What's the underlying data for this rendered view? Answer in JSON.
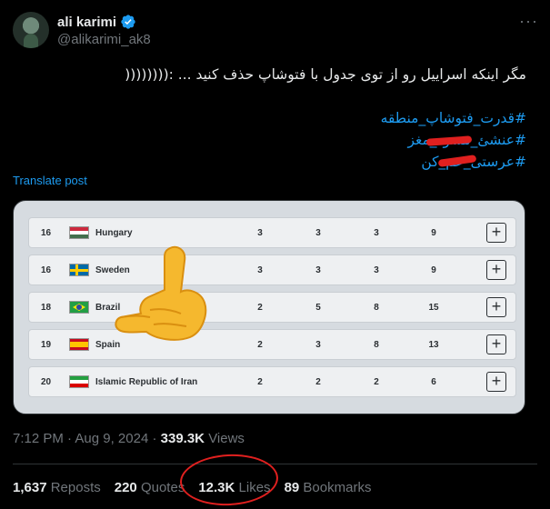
{
  "author": {
    "name": "ali karimi",
    "handle": "@alikarimi_ak8"
  },
  "tweet": {
    "text": "مگر اینکه اسراییل رو از توی جدول  با فتوشاپ حذف کنید ... :((((((((",
    "hashtags": [
      "#قدرت_فتوشاپ_منطقه",
      "#عنشئ_مسود_مغز",
      "#عرستی_عم_کن"
    ],
    "translate_label": "Translate post"
  },
  "medal_table": {
    "rows": [
      {
        "rank": "16",
        "country": "Hungary",
        "gold": "3",
        "silver": "3",
        "bronze": "3",
        "total": "9",
        "flag": "hungary-flag"
      },
      {
        "rank": "16",
        "country": "Sweden",
        "gold": "3",
        "silver": "3",
        "bronze": "3",
        "total": "9",
        "flag": "sweden-flag"
      },
      {
        "rank": "18",
        "country": "Brazil",
        "gold": "2",
        "silver": "5",
        "bronze": "8",
        "total": "15",
        "flag": "brazil-flag"
      },
      {
        "rank": "19",
        "country": "Spain",
        "gold": "2",
        "silver": "3",
        "bronze": "8",
        "total": "13",
        "flag": "spain-flag"
      },
      {
        "rank": "20",
        "country": "Islamic Republic of Iran",
        "gold": "2",
        "silver": "2",
        "bronze": "2",
        "total": "6",
        "flag": "iran-flag"
      }
    ],
    "expand_label": "+"
  },
  "meta": {
    "time": "7:12 PM",
    "separator": " · ",
    "date": "Aug 9, 2024",
    "views_count": "339.3K",
    "views_label": "Views"
  },
  "stats": {
    "reposts_count": "1,637",
    "reposts_label": "Reposts",
    "quotes_count": "220",
    "quotes_label": "Quotes",
    "likes_count": "12.3K",
    "likes_label": "Likes",
    "bookmarks_count": "89",
    "bookmarks_label": "Bookmarks"
  },
  "colors": {
    "background": "#000000",
    "accent": "#1d9bf0",
    "muted": "#71767b",
    "annotation_red": "#e0201f"
  }
}
